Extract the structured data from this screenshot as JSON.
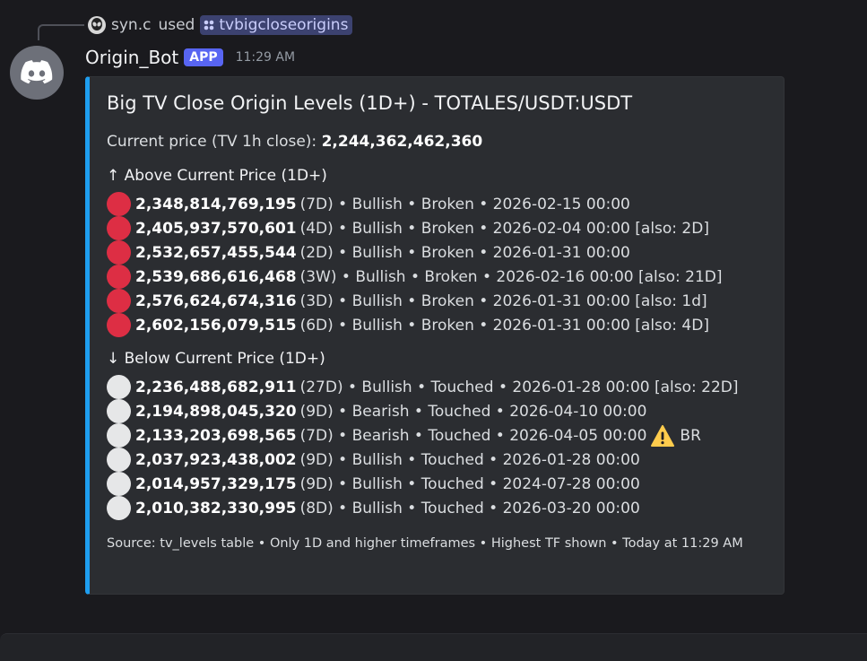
{
  "reply": {
    "user": "syn.c",
    "used_label": "used",
    "command": "tvbigcloseorigins"
  },
  "message": {
    "author": "Origin_Bot",
    "badge": "APP",
    "time": "11:29 AM"
  },
  "embed": {
    "accent_color": "#1e9ef0",
    "title": "Big TV Close Origin Levels (1D+) - TOTALES/USDT:USDT",
    "current_label": "Current price (TV 1h close):",
    "current_value": "2,244,362,462,360",
    "above_heading": "↑ Above Current Price (1D+)",
    "below_heading": "↓ Below Current Price (1D+)",
    "above": [
      {
        "price": "2,348,814,769,195",
        "detail": "(7D) • Bullish • Broken • 2026-02-15 00:00"
      },
      {
        "price": "2,405,937,570,601",
        "detail": "(4D) • Bullish • Broken • 2026-02-04 00:00 [also: 2D]"
      },
      {
        "price": "2,532,657,455,544",
        "detail": "(2D) • Bullish • Broken • 2026-01-31 00:00"
      },
      {
        "price": "2,539,686,616,468",
        "detail": "(3W) • Bullish • Broken • 2026-02-16 00:00 [also: 21D]"
      },
      {
        "price": "2,576,624,674,316",
        "detail": "(3D) • Bullish • Broken • 2026-01-31 00:00 [also: 1d]"
      },
      {
        "price": "2,602,156,079,515",
        "detail": "(6D) • Bullish • Broken • 2026-01-31 00:00 [also: 4D]"
      }
    ],
    "below": [
      {
        "price": "2,236,488,682,911",
        "detail": "(27D) • Bullish • Touched • 2026-01-28 00:00 [also: 22D]"
      },
      {
        "price": "2,194,898,045,320",
        "detail": "(9D) • Bearish • Touched • 2026-04-10 00:00"
      },
      {
        "price": "2,133,203,698,565",
        "detail": "(7D) • Bearish • Touched • 2026-04-05 00:00",
        "warning": "BR"
      },
      {
        "price": "2,037,923,438,002",
        "detail": "(9D) • Bullish • Touched • 2026-01-28 00:00"
      },
      {
        "price": "2,014,957,329,175",
        "detail": "(9D) • Bullish • Touched • 2024-07-28 00:00"
      },
      {
        "price": "2,010,382,330,995",
        "detail": "(8D) • Bullish • Touched • 2026-03-20 00:00"
      }
    ],
    "footer": "Source: tv_levels table • Only 1D and higher timeframes • Highest TF shown • Today at 11:29 AM"
  }
}
